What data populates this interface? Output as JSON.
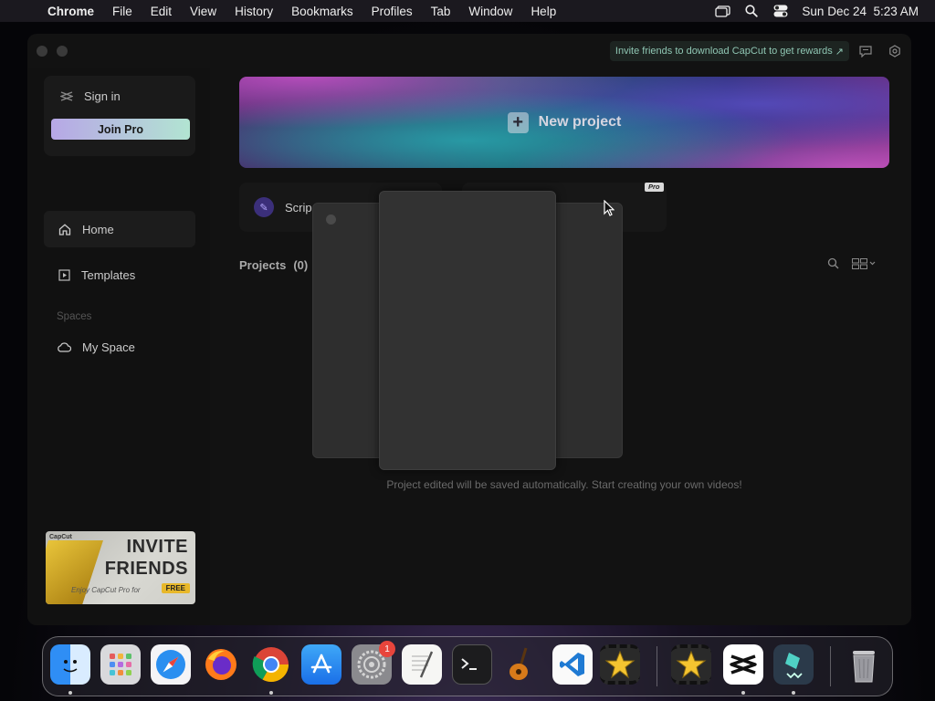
{
  "menubar": {
    "app": "Chrome",
    "items": [
      "File",
      "Edit",
      "View",
      "History",
      "Bookmarks",
      "Profiles",
      "Tab",
      "Window",
      "Help"
    ],
    "clock": "Sun Dec 24  5:23 AM"
  },
  "titlebar": {
    "invite": "Invite friends to download CapCut to get rewards",
    "invite_arrow": "↗"
  },
  "sidebar": {
    "sign_in": "Sign in",
    "join_pro": "Join Pro",
    "nav": [
      {
        "label": "Home",
        "icon": "home-icon"
      },
      {
        "label": "Templates",
        "icon": "templates-icon"
      }
    ],
    "spaces_label": "Spaces",
    "my_space": "My Space",
    "banner": {
      "brand": "CapCut",
      "line1": "INVITE",
      "line2": "FRIENDS",
      "sub": "Enjoy CapCut Pro for",
      "tag": "FREE"
    }
  },
  "main": {
    "new_project": "New project",
    "script_card": "Scrip",
    "pro_tag": "Pro",
    "projects_label": "Projects",
    "projects_count": "(0)",
    "empty_message": "Project edited will be saved automatically. Start creating your own videos!"
  },
  "dock": {
    "apps": [
      "Finder",
      "Launchpad",
      "Safari",
      "Firefox",
      "Chrome",
      "App Store",
      "System Settings",
      "TextEdit",
      "Terminal",
      "GarageBand",
      "Visual Studio Code",
      "iMovie",
      "iMovie",
      "CapCut",
      "Filmora",
      "Trash"
    ],
    "settings_badge": "1"
  },
  "colors": {
    "accent_teal": "#8fc6b3",
    "join_pro_gradient": [
      "#b7a7e6",
      "#b2e4d2"
    ],
    "badge_red": "#e8453c"
  }
}
